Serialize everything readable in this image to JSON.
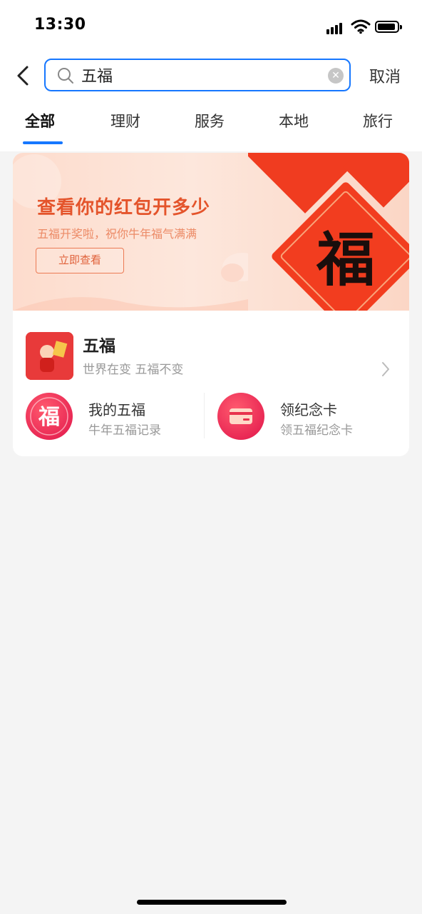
{
  "status_bar": {
    "time": "13:30"
  },
  "search": {
    "query": "五福",
    "cancel_label": "取消"
  },
  "tabs": [
    {
      "label": "全部"
    },
    {
      "label": "理财"
    },
    {
      "label": "服务"
    },
    {
      "label": "本地"
    },
    {
      "label": "旅行"
    }
  ],
  "banner": {
    "title": "查看你的红包开多少",
    "subtitle": "五福开奖啦，祝你牛年福气满满",
    "button_label": "立即查看",
    "art_char": "福"
  },
  "app": {
    "name": "五福",
    "subtitle": "世界在变  五福不变"
  },
  "sub_items": [
    {
      "title": "我的五福",
      "desc": "牛年五福记录",
      "icon": "fu-icon",
      "icon_char": "福"
    },
    {
      "title": "领纪念卡",
      "desc": "领五福纪念卡",
      "icon": "card-icon"
    }
  ],
  "colors": {
    "accent": "#1677ff",
    "banner_title": "#e4542b",
    "red": "#e83a3a"
  }
}
